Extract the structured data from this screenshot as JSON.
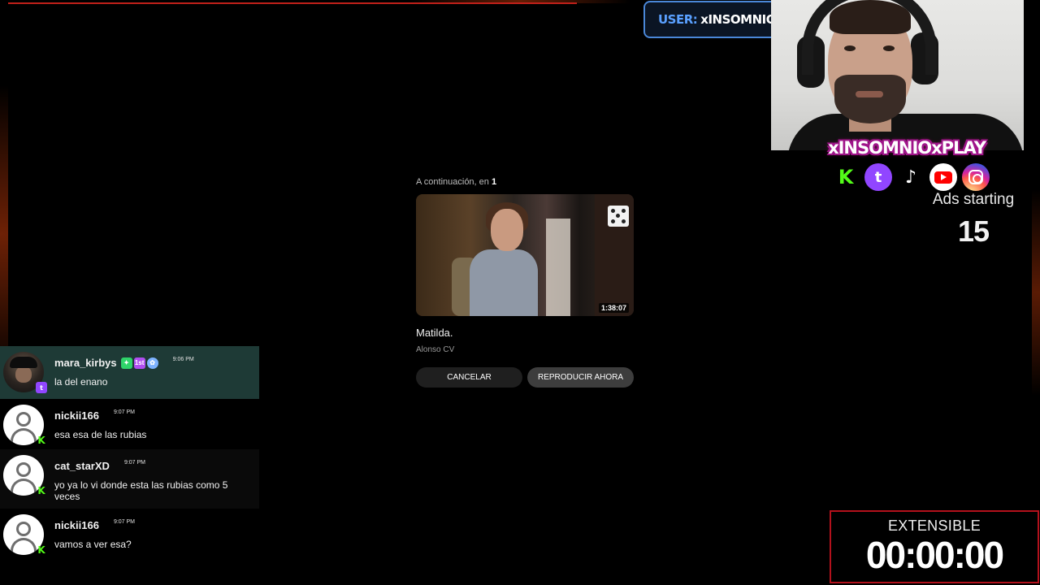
{
  "player": {
    "up_next_prefix": "A continuación, en",
    "up_next_seconds": "1",
    "video": {
      "duration": "1:38:07",
      "title": "Matilda.",
      "channel": "Alonso CV"
    },
    "cancel_label": "CANCELAR",
    "play_now_label": "REPRODUCIR AHORA"
  },
  "overlay": {
    "user_label": "USER:",
    "user_name": "xINSOMNIOx",
    "brand": "xINSOMNIOxPLAY",
    "socials": [
      {
        "name": "kick",
        "glyph": "K"
      },
      {
        "name": "twitch",
        "glyph": "t"
      },
      {
        "name": "tiktok",
        "glyph": "♪"
      },
      {
        "name": "youtube",
        "glyph": ""
      },
      {
        "name": "instagram",
        "glyph": ""
      }
    ],
    "ads_label": "Ads starting",
    "ads_countdown": "15",
    "timer_label": "EXTENSIBLE",
    "timer_value": "00:00:00"
  },
  "chat": {
    "messages": [
      {
        "user": "mara_kirbys",
        "time": "9:06 PM",
        "text": "la del enano",
        "platform": "twitch",
        "platform_glyph": "t",
        "badges": [
          "✦",
          "1st",
          "✿"
        ]
      },
      {
        "user": "nickii166",
        "time": "9:07 PM",
        "text": "esa esa de las rubias",
        "platform": "kick",
        "platform_glyph": "K"
      },
      {
        "user": "cat_starXD",
        "time": "9:07 PM",
        "text": "yo ya lo vi donde esta las rubias como 5 veces",
        "platform": "kick",
        "platform_glyph": "K"
      },
      {
        "user": "nickii166",
        "time": "9:07 PM",
        "text": "vamos a ver esa?",
        "platform": "kick",
        "platform_glyph": "K"
      }
    ]
  },
  "colors": {
    "accent_red": "#c0201a",
    "kick_green": "#53fc18",
    "twitch_purple": "#9146ff",
    "highlight_row": "#1e3a36",
    "user_badge_border": "#4a87d8"
  }
}
